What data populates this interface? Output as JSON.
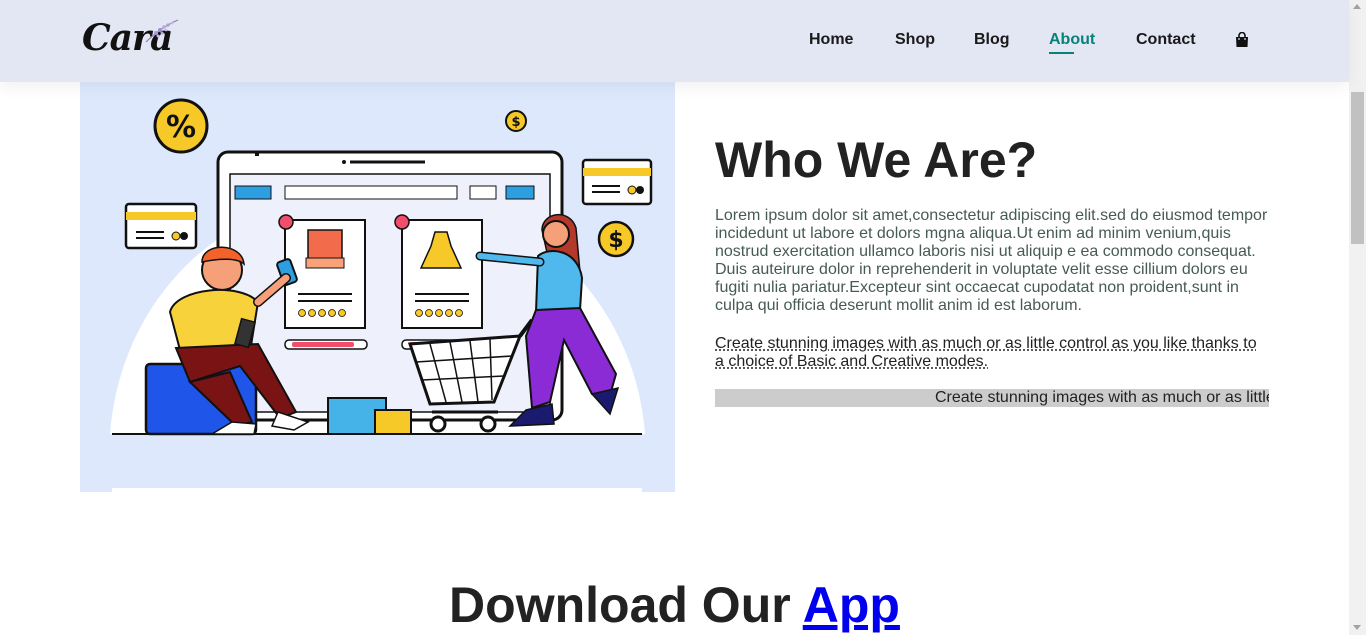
{
  "header": {
    "logo_text": "Cara",
    "nav": [
      {
        "label": "Home"
      },
      {
        "label": "Shop"
      },
      {
        "label": "Blog"
      },
      {
        "label": "About",
        "active": true
      },
      {
        "label": "Contact"
      }
    ],
    "cart_icon": "shopping-bag-icon"
  },
  "about": {
    "title": "Who We Are?",
    "paragraph": "Lorem ipsum dolor sit amet,consectetur adipiscing elit.sed do eiusmod tempor incidedunt ut labore et dolors mgna aliqua.Ut enim ad minim venium,quis nostrud exercitation ullamco laboris nisi ut aliquip e ea commodo consequat. Duis auteirure dolor in reprehenderit in voluptate velit esse cillium dolors eu fugiti nulia pariatur.Excepteur sint occaecat cupodatat non proident,sunt in culpa qui officia deserunt mollit anim id est laborum.",
    "abbr_text": "Create stunning images with as much or as little control as you like thanks to a choice of Basic and Creative modes.",
    "marquee_text": "Create stunning images with as much or as little control as you like thanks to a choice of Basic and Creative modes."
  },
  "illustration": {
    "percent_badge": "%",
    "dollar_badge": "$",
    "small_dollar": "$"
  },
  "download": {
    "prefix": "Download Our ",
    "link": "App"
  },
  "colors": {
    "header_bg": "#e3e6f3",
    "accent": "#088178",
    "illustration_bg": "#dde8fd",
    "marquee_bg": "#cccccc",
    "link": "#0000ee"
  }
}
